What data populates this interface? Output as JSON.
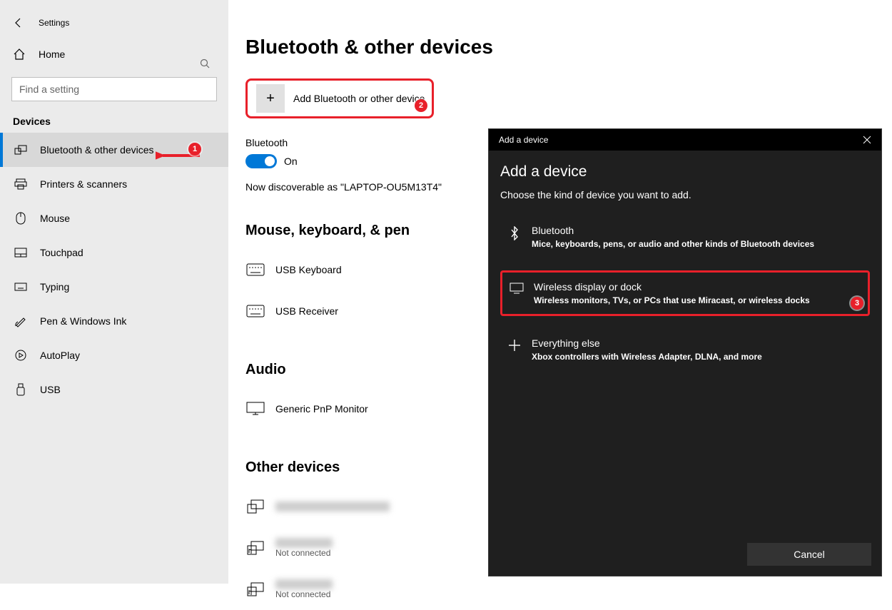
{
  "sidebar": {
    "app_title": "Settings",
    "home": "Home",
    "search_placeholder": "Find a setting",
    "section": "Devices",
    "items": [
      {
        "label": "Bluetooth & other devices"
      },
      {
        "label": "Printers & scanners"
      },
      {
        "label": "Mouse"
      },
      {
        "label": "Touchpad"
      },
      {
        "label": "Typing"
      },
      {
        "label": "Pen & Windows Ink"
      },
      {
        "label": "AutoPlay"
      },
      {
        "label": "USB"
      }
    ]
  },
  "main": {
    "title": "Bluetooth & other devices",
    "add_device": "Add Bluetooth or other device",
    "bluetooth_label": "Bluetooth",
    "toggle_state": "On",
    "discoverable": "Now discoverable as \"LAPTOP-OU5M13T4\"",
    "section_mouse": "Mouse, keyboard, & pen",
    "mouse_items": [
      {
        "name": "USB Keyboard"
      },
      {
        "name": "USB Receiver"
      }
    ],
    "section_audio": "Audio",
    "audio_items": [
      {
        "name": "Generic PnP Monitor"
      }
    ],
    "section_other": "Other devices",
    "not_connected": "Not connected"
  },
  "dialog": {
    "titlebar": "Add a device",
    "heading": "Add a device",
    "sub": "Choose the kind of device you want to add.",
    "options": [
      {
        "title": "Bluetooth",
        "desc": "Mice, keyboards, pens, or audio and other kinds of Bluetooth devices"
      },
      {
        "title": "Wireless display or dock",
        "desc": "Wireless monitors, TVs, or PCs that use Miracast, or wireless docks"
      },
      {
        "title": "Everything else",
        "desc": "Xbox controllers with Wireless Adapter, DLNA, and more"
      }
    ],
    "cancel": "Cancel"
  },
  "annotations": {
    "b1": "1",
    "b2": "2",
    "b3": "3"
  }
}
